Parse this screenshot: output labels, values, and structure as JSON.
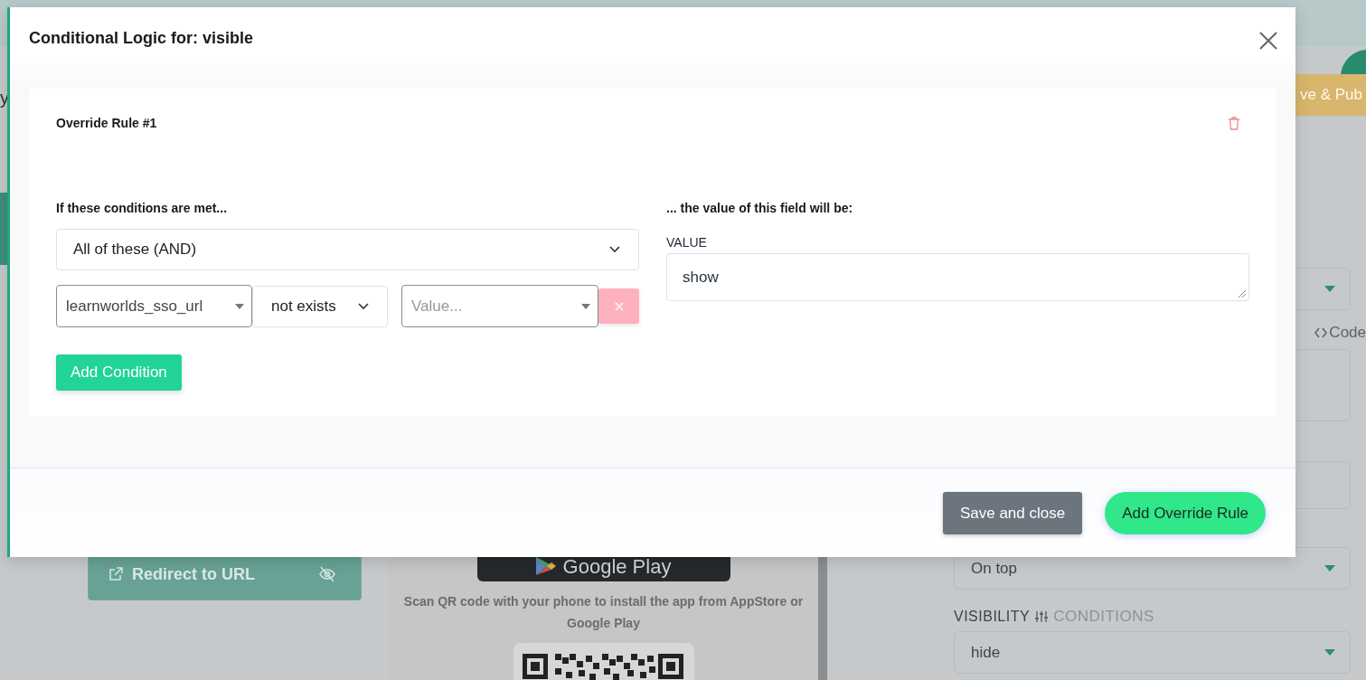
{
  "header": {
    "cut_text": "y"
  },
  "publish_button": {
    "label": "ve & Pub"
  },
  "redirect_button": {
    "label": "Redirect to URL"
  },
  "app_download": {
    "badge_label": "Google Play",
    "instructions": "Scan QR code with your phone to install the app from AppStore or Google Play"
  },
  "settings_panel": {
    "code_link": "Code",
    "position_select": {
      "value": "On top"
    },
    "visibility": {
      "label": "VISIBILITY",
      "conditions_link": "CONDITIONS",
      "value": "hide"
    }
  },
  "modal": {
    "title": "Conditional Logic for: visible",
    "rules": [
      {
        "title": "Override Rule #1",
        "conditions_heading": "If these conditions are met...",
        "match_select": "All of these (AND)",
        "conditions": [
          {
            "field": "learnworlds_sso_url",
            "operator": "not exists",
            "value_placeholder": "Value..."
          }
        ],
        "add_condition_button": "Add Condition",
        "result_heading": "... the value of this field will be:",
        "value_label": "VALUE",
        "value": "show"
      }
    ],
    "buttons": [
      {
        "label": "Save and close",
        "kind": "secondary"
      },
      {
        "label": "Add Override Rule",
        "kind": "primary"
      }
    ]
  }
}
